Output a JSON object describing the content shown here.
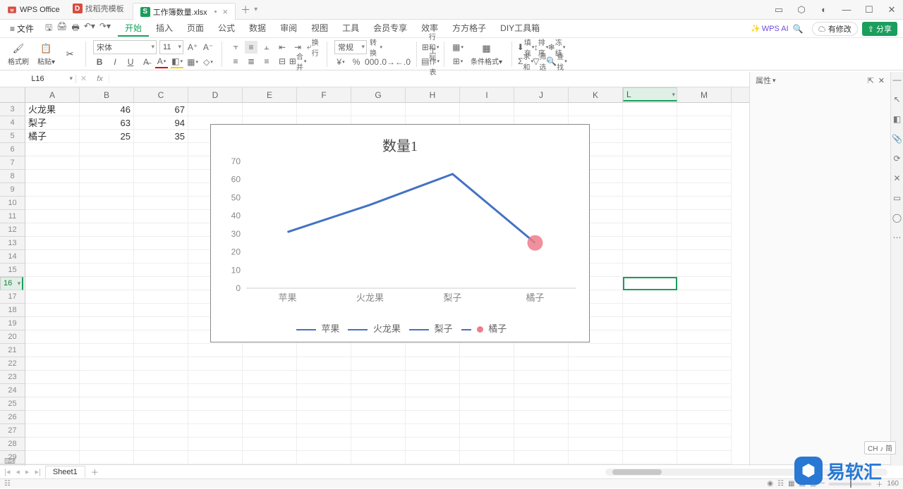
{
  "app": {
    "name": "WPS Office"
  },
  "tabs": [
    {
      "icon_bg": "#d94b3f",
      "icon_txt": "D",
      "label": "找稻壳模板"
    },
    {
      "icon_bg": "#1a9e5c",
      "icon_txt": "S",
      "label": "工作簿数量.xlsx",
      "active": true
    }
  ],
  "menubar": {
    "file": "文件",
    "items": [
      "开始",
      "插入",
      "页面",
      "公式",
      "数据",
      "审阅",
      "视图",
      "工具",
      "会员专享",
      "效率",
      "方方格子",
      "DIY工具箱"
    ],
    "active": 0,
    "ai": "WPS AI",
    "modified": "有修改",
    "share": "分享"
  },
  "ribbon": {
    "formatpainter": "格式刷",
    "paste": "粘贴",
    "font": "宋体",
    "size": "11",
    "general": "常规",
    "convert": "转换",
    "rowcol": "行和列",
    "worksheet": "工作表",
    "condfmt": "条件格式",
    "fill": "填充",
    "sort": "排序",
    "freeze": "冻结",
    "sum": "求和",
    "filter": "筛选",
    "find": "查找",
    "wrap": "换行",
    "merge": "合并"
  },
  "namebox": "L16",
  "columns": [
    "A",
    "B",
    "C",
    "D",
    "E",
    "F",
    "G",
    "H",
    "I",
    "J",
    "K",
    "L",
    "M"
  ],
  "selcol": 11,
  "rowstart": 3,
  "rowcount": 27,
  "selrow": 16,
  "cells": [
    [
      "火龙果",
      "46",
      "67"
    ],
    [
      "梨子",
      "63",
      "94"
    ],
    [
      "橘子",
      "25",
      "35"
    ]
  ],
  "chart_data": {
    "type": "line",
    "title": "数量1",
    "categories": [
      "苹果",
      "火龙果",
      "梨子",
      "橘子"
    ],
    "series": [
      {
        "name": "数量1",
        "values": [
          31,
          46,
          63,
          25
        ]
      }
    ],
    "ylim": [
      0,
      70
    ],
    "yticks": [
      0,
      10,
      20,
      30,
      40,
      50,
      60,
      70
    ],
    "legend": [
      "苹果",
      "火龙果",
      "梨子",
      "橘子"
    ],
    "highlight_index": 3
  },
  "sheet": "Sheet1",
  "zoom": "160",
  "ime": "CH ♪ 简",
  "prop_title": "属性",
  "watermark": "易软汇"
}
